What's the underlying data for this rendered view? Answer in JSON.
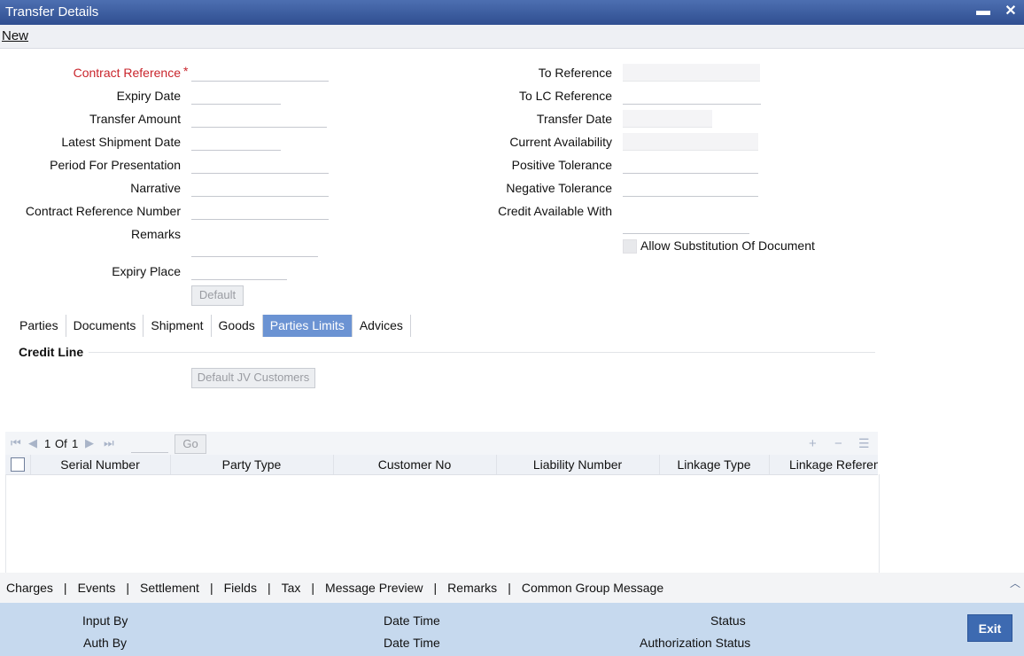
{
  "window": {
    "title": "Transfer Details",
    "minimize_glyph": "▬",
    "close_glyph": "✕"
  },
  "menu": {
    "new_label": "New"
  },
  "left_fields": {
    "contract_reference": "Contract Reference",
    "required_mark": "*",
    "expiry_date": "Expiry Date",
    "transfer_amount": "Transfer Amount",
    "latest_shipment_date": "Latest Shipment Date",
    "period_for_presentation": "Period For Presentation",
    "narrative": "Narrative",
    "contract_reference_number": "Contract Reference Number",
    "remarks": "Remarks",
    "expiry_place": "Expiry Place",
    "default_button": "Default"
  },
  "right_fields": {
    "to_reference": "To Reference",
    "to_lc_reference": "To LC Reference",
    "transfer_date": "Transfer Date",
    "current_availability": "Current Availability",
    "positive_tolerance": "Positive Tolerance",
    "negative_tolerance": "Negative Tolerance",
    "credit_available_with": "Credit Available With",
    "allow_substitution": "Allow Substitution Of Document"
  },
  "tabs": [
    {
      "label": "Parties"
    },
    {
      "label": "Documents"
    },
    {
      "label": "Shipment"
    },
    {
      "label": "Goods"
    },
    {
      "label": "Parties Limits"
    },
    {
      "label": "Advices"
    }
  ],
  "credit_line": {
    "title": "Credit Line",
    "default_jv_button": "Default JV Customers"
  },
  "grid": {
    "page_current": "1",
    "page_of": "Of",
    "page_total": "1",
    "go_label": "Go",
    "columns": [
      "Serial Number",
      "Party Type",
      "Customer No",
      "Liability Number",
      "Linkage Type",
      "Linkage Reference"
    ]
  },
  "bottom_links": [
    "Charges",
    "Events",
    "Settlement",
    "Fields",
    "Tax",
    "Message Preview",
    "Remarks",
    "Common Group Message"
  ],
  "footer": {
    "input_by": "Input By",
    "auth_by": "Auth By",
    "date_time_1": "Date Time",
    "date_time_2": "Date Time",
    "status": "Status",
    "authorization_status": "Authorization Status",
    "exit_label": "Exit"
  },
  "colors": {
    "titlebar": "#2f4e90",
    "active_tab": "#6b93d3",
    "footer": "#c6d9ee",
    "exit_button": "#3d6ab1",
    "required": "#c9252c"
  }
}
